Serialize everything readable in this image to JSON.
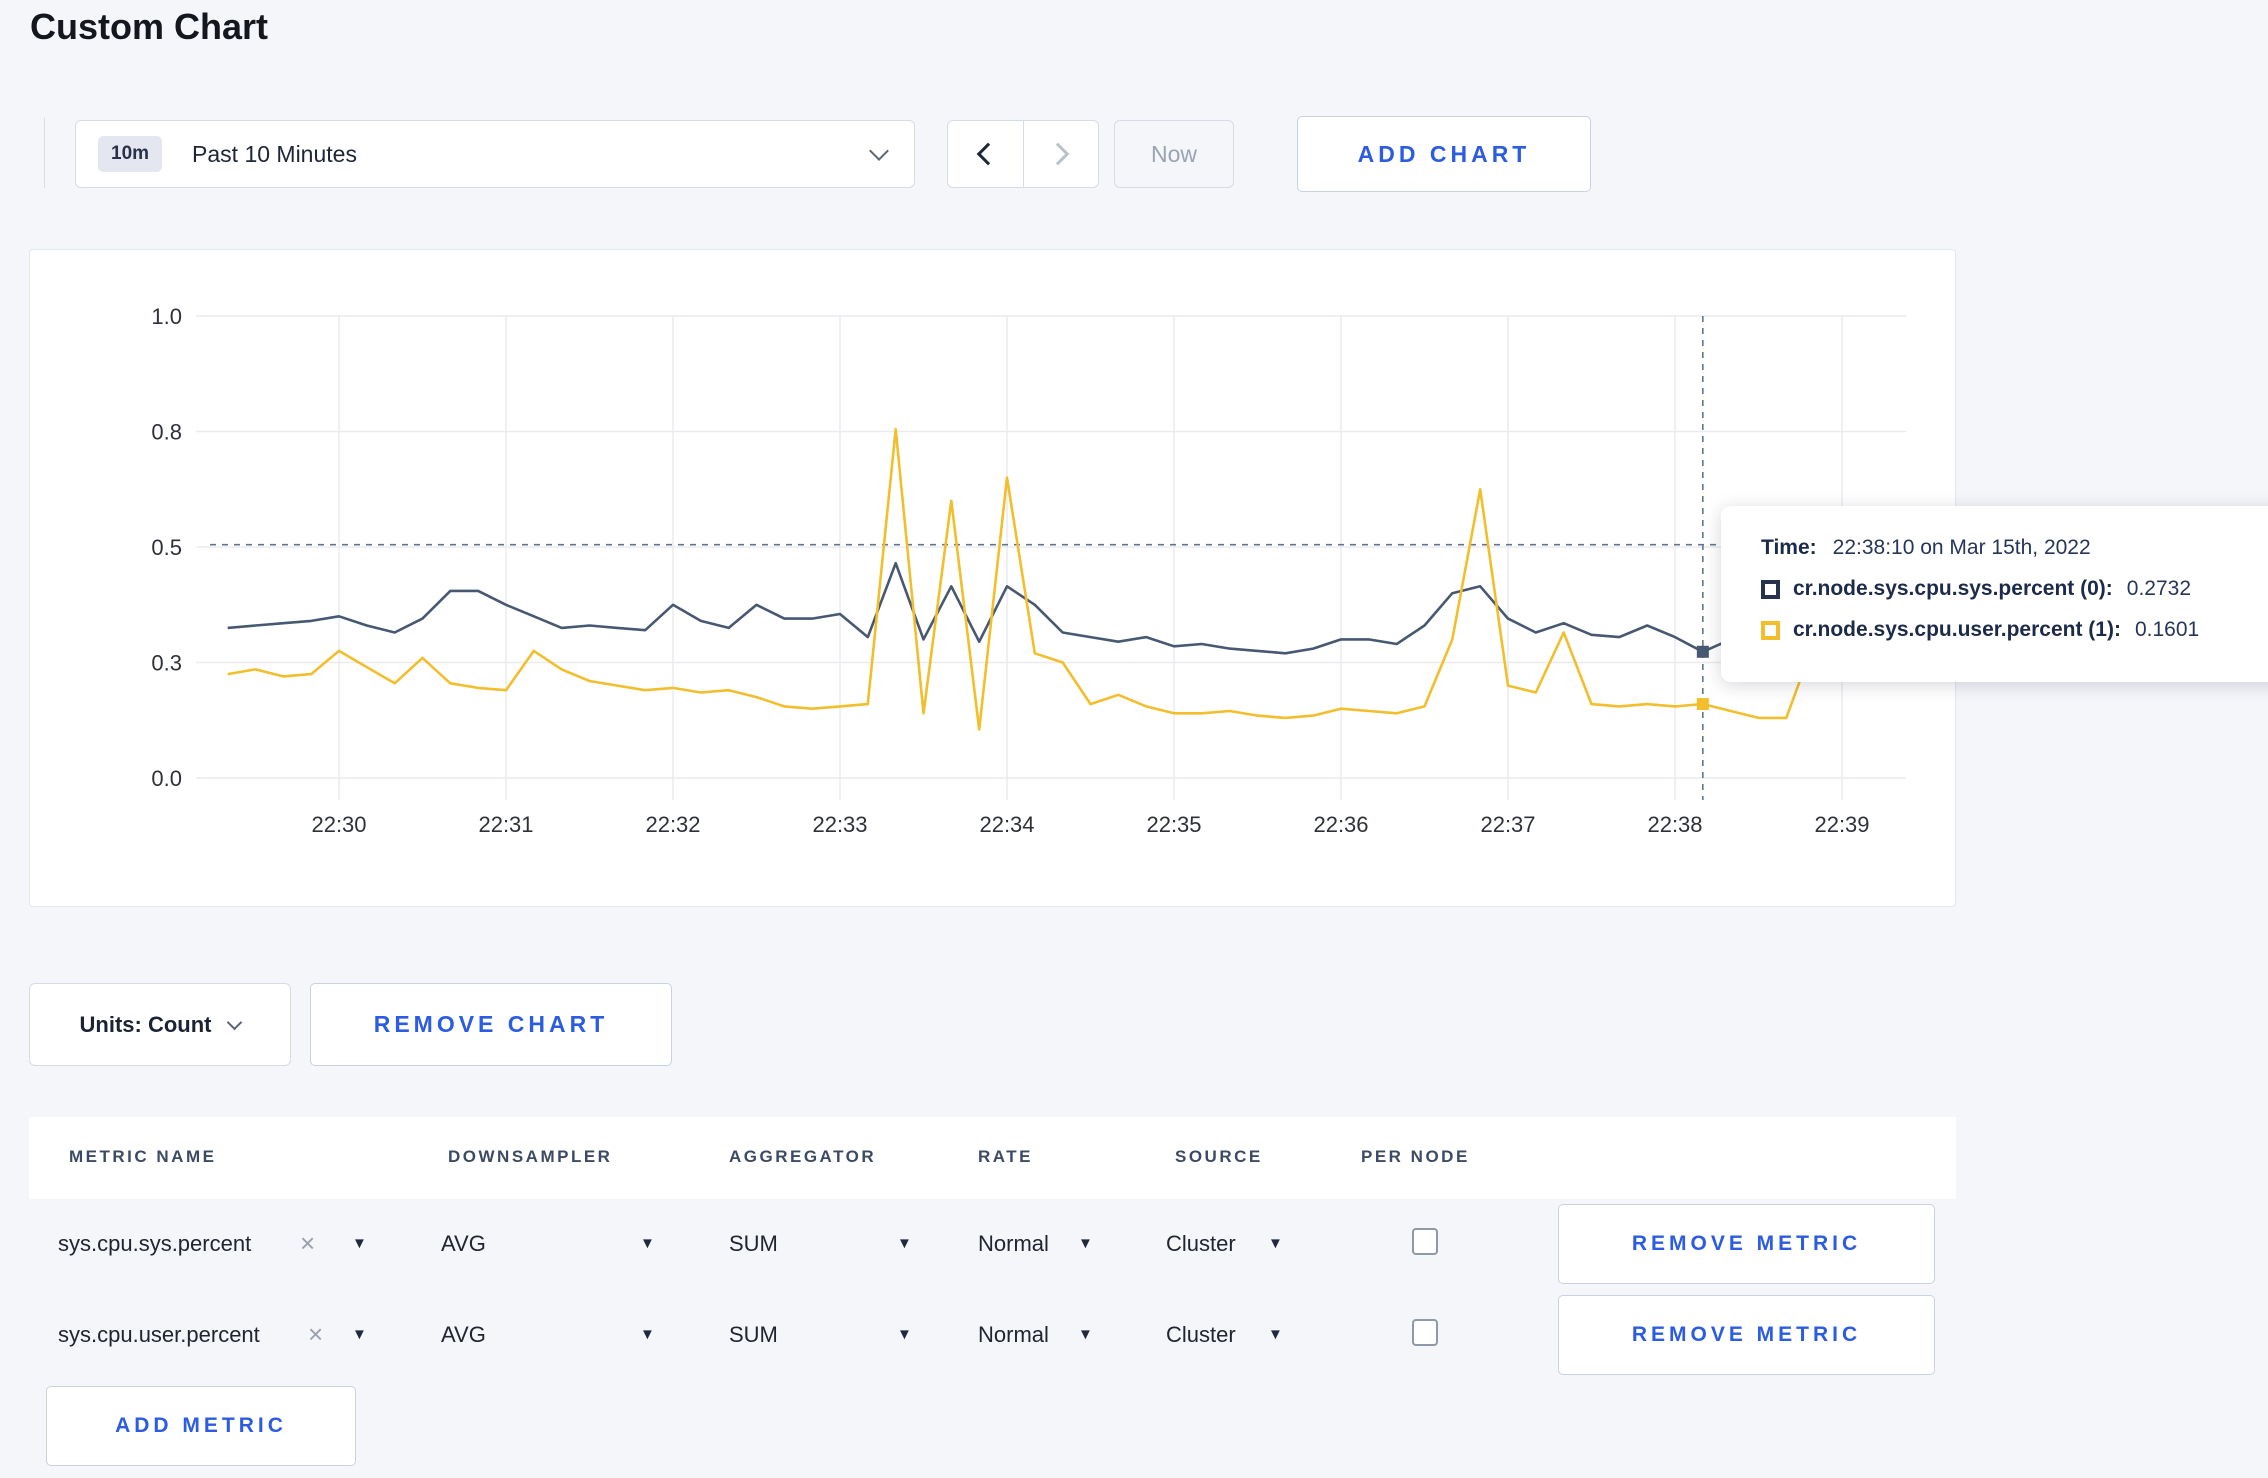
{
  "page": {
    "title": "Custom Chart"
  },
  "toolbar": {
    "time_badge": "10m",
    "time_label": "Past 10 Minutes",
    "now_label": "Now",
    "add_chart_label": "ADD CHART"
  },
  "chart_controls": {
    "units_label": "Units: Count",
    "remove_chart_label": "REMOVE CHART"
  },
  "tooltip": {
    "time_label": "Time:",
    "time_value": "22:38:10 on Mar 15th, 2022",
    "series": [
      {
        "label": "cr.node.sys.cpu.sys.percent (0):",
        "value": "0.2732",
        "color": "#26334d"
      },
      {
        "label": "cr.node.sys.cpu.user.percent (1):",
        "value": "0.1601",
        "color": "#f2be2c"
      }
    ]
  },
  "chart_data": {
    "type": "line",
    "title": "",
    "xlabel": "",
    "ylabel": "",
    "ylim": [
      0,
      1
    ],
    "grid": true,
    "legend_position": "tooltip",
    "y_ticks": [
      {
        "value": 0,
        "label": "0.0"
      },
      {
        "value": 0.25,
        "label": "0.3"
      },
      {
        "value": 0.5,
        "label": "0.5"
      },
      {
        "value": 0.75,
        "label": "0.8"
      },
      {
        "value": 1,
        "label": "1.0"
      }
    ],
    "x_ticks": [
      {
        "seconds": 60,
        "label": "22:30"
      },
      {
        "seconds": 120,
        "label": "22:31"
      },
      {
        "seconds": 180,
        "label": "22:32"
      },
      {
        "seconds": 240,
        "label": "22:33"
      },
      {
        "seconds": 300,
        "label": "22:34"
      },
      {
        "seconds": 360,
        "label": "22:35"
      },
      {
        "seconds": 420,
        "label": "22:36"
      },
      {
        "seconds": 480,
        "label": "22:37"
      },
      {
        "seconds": 540,
        "label": "22:38"
      },
      {
        "seconds": 600,
        "label": "22:39"
      }
    ],
    "x_start_seconds": 20,
    "x_step_seconds": 10,
    "series": [
      {
        "name": "cr.node.sys.cpu.sys.percent",
        "color": "#475872",
        "values": [
          0.325,
          0.33,
          0.335,
          0.34,
          0.35,
          0.33,
          0.315,
          0.345,
          0.405,
          0.405,
          0.375,
          0.35,
          0.325,
          0.33,
          0.325,
          0.32,
          0.375,
          0.34,
          0.325,
          0.375,
          0.345,
          0.345,
          0.355,
          0.305,
          0.465,
          0.3,
          0.415,
          0.295,
          0.415,
          0.375,
          0.315,
          0.305,
          0.295,
          0.305,
          0.285,
          0.29,
          0.28,
          0.275,
          0.27,
          0.28,
          0.3,
          0.3,
          0.29,
          0.33,
          0.4,
          0.415,
          0.345,
          0.315,
          0.335,
          0.31,
          0.305,
          0.33,
          0.305,
          0.2732,
          0.3,
          0.295,
          0.3,
          0.31,
          0.3,
          0.305,
          0.3
        ]
      },
      {
        "name": "cr.node.sys.cpu.user.percent",
        "color": "#f2be2c",
        "values": [
          0.225,
          0.235,
          0.22,
          0.225,
          0.275,
          0.24,
          0.205,
          0.26,
          0.205,
          0.195,
          0.19,
          0.275,
          0.235,
          0.21,
          0.2,
          0.19,
          0.195,
          0.185,
          0.19,
          0.175,
          0.155,
          0.15,
          0.155,
          0.16,
          0.755,
          0.14,
          0.6,
          0.105,
          0.65,
          0.27,
          0.25,
          0.16,
          0.18,
          0.155,
          0.14,
          0.14,
          0.145,
          0.135,
          0.13,
          0.135,
          0.15,
          0.145,
          0.14,
          0.155,
          0.3,
          0.625,
          0.2,
          0.185,
          0.315,
          0.16,
          0.155,
          0.16,
          0.155,
          0.1601,
          0.145,
          0.13,
          0.13,
          0.295,
          0.3,
          0.215,
          0.27
        ]
      }
    ],
    "crosshair": {
      "x_seconds": 550,
      "y_value": 0.505,
      "point_values": [
        0.2732,
        0.1601
      ]
    }
  },
  "metrics_table": {
    "headers": [
      "METRIC NAME",
      "DOWNSAMPLER",
      "AGGREGATOR",
      "RATE",
      "SOURCE",
      "PER NODE"
    ],
    "rows": [
      {
        "metric": "sys.cpu.sys.percent",
        "downsampler": "AVG",
        "aggregator": "SUM",
        "rate": "Normal",
        "source": "Cluster",
        "per_node_checked": false,
        "remove_label": "REMOVE METRIC"
      },
      {
        "metric": "sys.cpu.user.percent",
        "downsampler": "AVG",
        "aggregator": "SUM",
        "rate": "Normal",
        "source": "Cluster",
        "per_node_checked": false,
        "remove_label": "REMOVE METRIC"
      }
    ],
    "add_metric_label": "ADD METRIC"
  }
}
